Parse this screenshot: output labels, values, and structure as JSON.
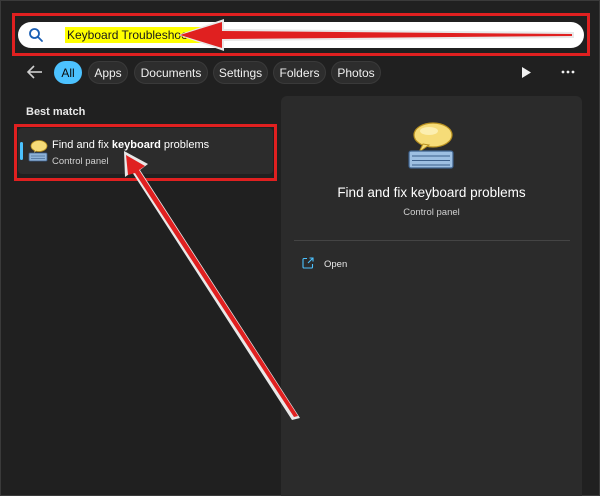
{
  "search": {
    "value": "Keyboard Troubleshooter"
  },
  "filters": [
    "All",
    "Apps",
    "Documents",
    "Settings",
    "Folders",
    "Photos"
  ],
  "best_match_label": "Best match",
  "result": {
    "title_prefix": "Find and fix ",
    "title_bold": "keyboard",
    "title_suffix": " problems",
    "subtitle": "Control panel"
  },
  "preview": {
    "title": "Find and fix keyboard problems",
    "subtitle": "Control panel",
    "action_open": "Open"
  },
  "colors": {
    "background": "#202020",
    "accent": "#4cc2ff",
    "highlight": "#ffff00",
    "annotation_red": "#e02020"
  },
  "icons": [
    "search-icon",
    "back-arrow-icon",
    "play-icon",
    "more-icon",
    "keyboard-help-icon",
    "open-external-icon"
  ]
}
